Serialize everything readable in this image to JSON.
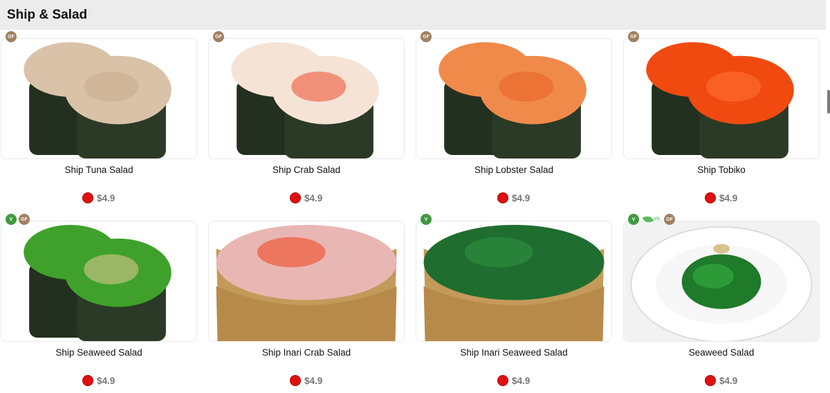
{
  "header": {
    "title": "Ship & Salad"
  },
  "colors": {
    "header_bg": "#ececec",
    "price_dot": "#e01010",
    "gf_badge": "#a08060",
    "v_badge": "#3f9a3f"
  },
  "items": [
    {
      "name": "Ship Tuna Salad",
      "price": "$4.9",
      "badges": [
        "GF"
      ],
      "topping": "#d9c2a8",
      "topping_accent": "#c9ad8e",
      "kind": "gunkan"
    },
    {
      "name": "Ship Crab Salad",
      "price": "$4.9",
      "badges": [
        "GF"
      ],
      "topping": "#f5e3d6",
      "topping_accent": "#ee5a3c",
      "kind": "gunkan"
    },
    {
      "name": "Ship Lobster Salad",
      "price": "$4.9",
      "badges": [
        "GF"
      ],
      "topping": "#f08a4a",
      "topping_accent": "#e8642a",
      "kind": "gunkan"
    },
    {
      "name": "Ship Tobiko",
      "price": "$4.9",
      "badges": [
        "GF"
      ],
      "topping": "#f04a10",
      "topping_accent": "#ff7030",
      "kind": "gunkan"
    },
    {
      "name": "Ship Seaweed Salad",
      "price": "$4.9",
      "badges": [
        "V",
        "GF"
      ],
      "topping": "#3fa12c",
      "topping_accent": "#d8c48a",
      "kind": "gunkan"
    },
    {
      "name": "Ship Inari Crab Salad",
      "price": "$4.9",
      "badges": [],
      "topping": "#e9b7b3",
      "topping_accent": "#ee5a3c",
      "kind": "inari"
    },
    {
      "name": "Ship Inari Seaweed Salad",
      "price": "$4.9",
      "badges": [
        "V"
      ],
      "topping": "#1f6e2f",
      "topping_accent": "#2d8a3e",
      "kind": "inari"
    },
    {
      "name": "Seaweed Salad",
      "price": "$4.9",
      "badges": [
        "V",
        "VG",
        "GF"
      ],
      "topping": "#1f7a2a",
      "topping_accent": "#d8c48a",
      "kind": "plate"
    }
  ]
}
